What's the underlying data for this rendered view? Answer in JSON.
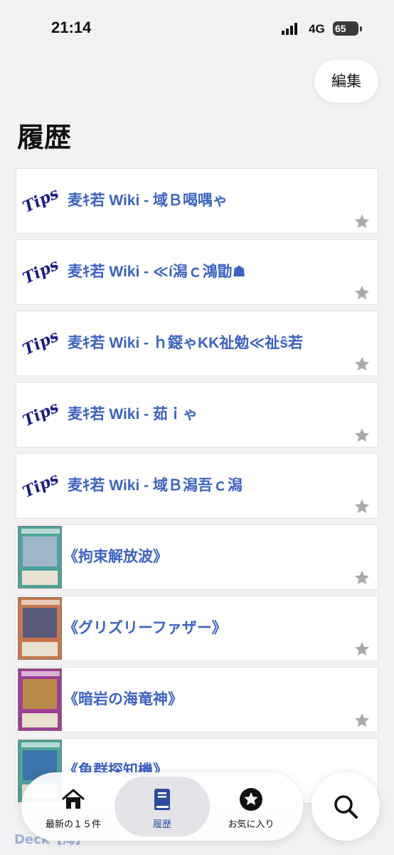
{
  "status": {
    "time": "21:14",
    "network": "4G",
    "battery": "65"
  },
  "header": {
    "edit_label": "編集",
    "title": "履歴"
  },
  "history": [
    {
      "kind": "tips",
      "logo": "Tips",
      "title": "麦ｷ若 Wiki - 域Ｂ喝喁ゃ"
    },
    {
      "kind": "tips",
      "logo": "Tips",
      "title": "麦ｷ若 Wiki - ≪í潟ｃ鴻勖☗"
    },
    {
      "kind": "tips",
      "logo": "Tips",
      "title": "麦ｷ若 Wiki - ｈ鐚ゃKK祉勉≪祉ŝ若"
    },
    {
      "kind": "tips",
      "logo": "Tips",
      "title": "麦ｷ若 Wiki - 茹ｉゃ"
    },
    {
      "kind": "tips",
      "logo": "Tips",
      "title": "麦ｷ若 Wiki - 域Ｂ潟吾ｃ潟"
    },
    {
      "kind": "card",
      "title": "《拘束解放波》",
      "frame": "#4ea39a",
      "art": "#9fb6c8"
    },
    {
      "kind": "card",
      "title": "《グリズリーファザー》",
      "frame": "#c9764d",
      "art": "#5b5a78"
    },
    {
      "kind": "card",
      "title": "《暗岩の海竜神》",
      "frame": "#9d3f94",
      "art": "#b98a4a"
    },
    {
      "kind": "card",
      "title": "《魚群探知機》",
      "frame": "#4ea39a",
      "art": "#3b74a8"
    }
  ],
  "peek_text": "Deck【海】",
  "tabs": [
    {
      "label": "最新の１５件",
      "icon": "house-icon",
      "active": false
    },
    {
      "label": "履歴",
      "icon": "book-icon",
      "active": true
    },
    {
      "label": "お気に入り",
      "icon": "star-circle-icon",
      "active": false
    }
  ],
  "search": {
    "icon": "search-icon"
  },
  "colors": {
    "link": "#3c63c0",
    "accent": "#2b4c9e",
    "star": "#a9a9ad"
  }
}
